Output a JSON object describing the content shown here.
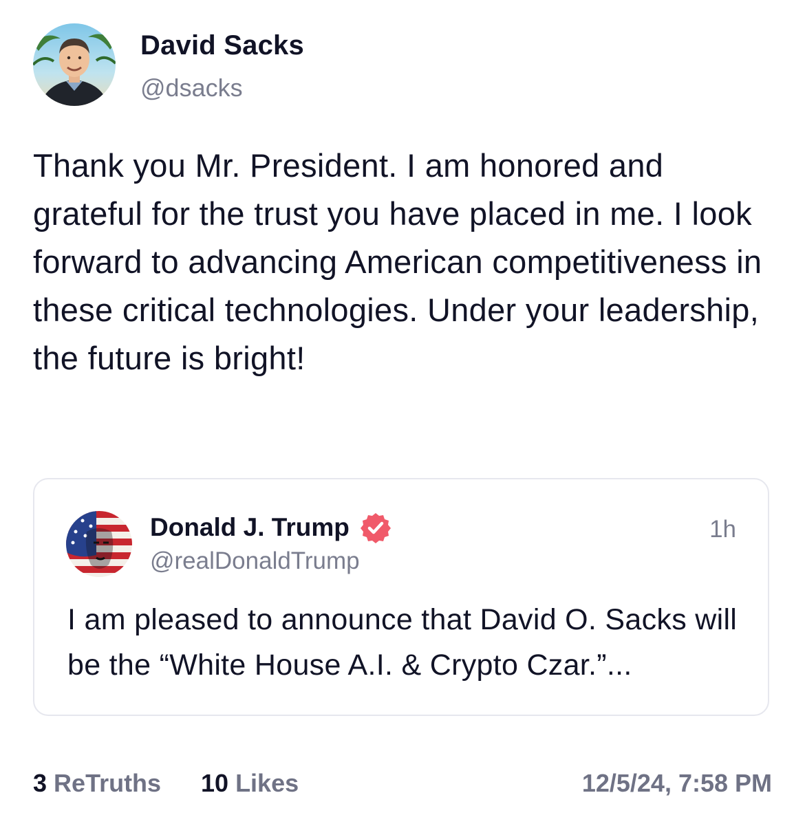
{
  "post": {
    "author": {
      "name": "David Sacks",
      "handle": "@dsacks",
      "avatar_icon": "avatar-photo-icon"
    },
    "body": "Thank you Mr. President. I am honored and grateful for the trust you have placed in me. I look forward to advancing American competitiveness in these critical technologies. Under your leadership, the future is bright!"
  },
  "quoted_post": {
    "author": {
      "name": "Donald J. Trump",
      "handle": "@realDonaldTrump",
      "verified": true,
      "avatar_icon": "flag-portrait-icon"
    },
    "time": "1h",
    "body": "I am pleased to announce that David O. Sacks will be the “White House A.I. & Crypto Czar.”..."
  },
  "footer": {
    "retruths_count": "3",
    "retruths_label": "ReTruths",
    "likes_count": "10",
    "likes_label": "Likes",
    "timestamp": "12/5/24, 7:58 PM"
  },
  "colors": {
    "text": "#111326",
    "muted": "#7a7d8e",
    "border": "#e6e7ee",
    "verified": "#f05a6a"
  }
}
